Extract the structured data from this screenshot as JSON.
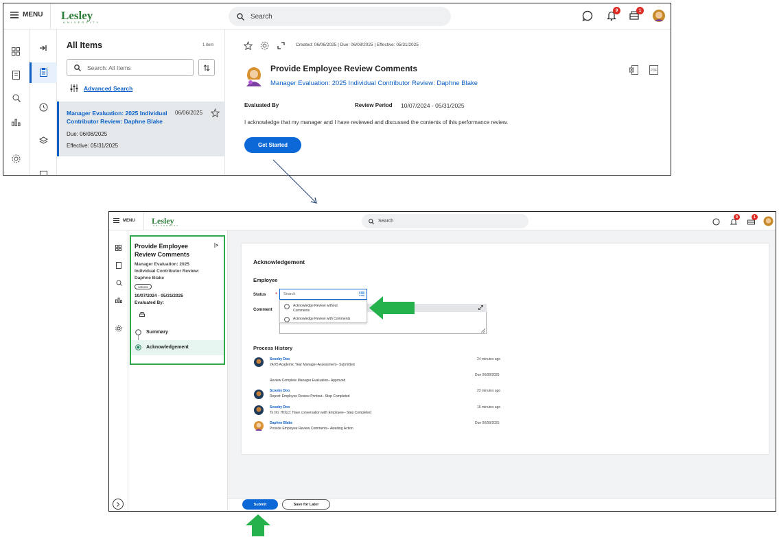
{
  "screen1": {
    "header": {
      "menu_label": "MENU",
      "logo": "Lesley",
      "logo_sub": "UNIVERSITY",
      "search_placeholder": "Search",
      "notifications_count": "9",
      "inbox_count": "1"
    },
    "list": {
      "title": "All Items",
      "count": "1 item",
      "search_placeholder": "Search: All Items",
      "advanced_search": "Advanced Search",
      "card": {
        "title": "Manager Evaluation: 2025 Individual Contributor Review: Daphne Blake",
        "date": "06/06/2025",
        "due": "Due: 06/08/2025",
        "effective": "Effective: 05/31/2025"
      }
    },
    "detail": {
      "meta": "Created: 06/06/2025 | Due: 06/08/2025 | Effective: 05/31/2025",
      "title": "Provide Employee Review Comments",
      "subtitle": "Manager Evaluation: 2025 Individual Contributor Review: Daphne Blake",
      "evaluated_by_label": "Evaluated By",
      "review_period_label": "Review Period",
      "review_period_value": "10/07/2024 - 05/31/2025",
      "acknowledgement": "I acknowledge that my manager and I have reviewed and discussed the contents of this performance review.",
      "get_started": "Get Started"
    }
  },
  "screen2": {
    "header": {
      "menu_label": "MENU",
      "logo": "Lesley",
      "logo_sub": "UNIVERSITY",
      "search_placeholder": "Search",
      "notifications_count": "9",
      "inbox_count": "1"
    },
    "side": {
      "title": "Provide Employee Review Comments",
      "subtitle": "Manager Evaluation: 2025 Individual Contributor Review: Daphne Blake",
      "actions": "Actions",
      "dates": "10/07/2024 - 05/31/2025",
      "evaluated_by": "Evaluated By:",
      "step_summary": "Summary",
      "step_ack": "Acknowledgement"
    },
    "form": {
      "heading": "Acknowledgement",
      "section": "Employee",
      "status_label": "Status",
      "status_placeholder": "Search",
      "options": [
        "Acknowledge Review without Comments",
        "Acknowledge Review with Comments"
      ],
      "comment_label": "Comment"
    },
    "history": {
      "heading": "Process History",
      "entries": [
        {
          "name": "Scooby Doo",
          "desc": "24/25 Academic Year Manager-Assessment– Submitted",
          "time": "24 minutes ago"
        },
        {
          "name": "",
          "desc": "Review Complete Manager Evaluation– Approved",
          "time": "Due 06/08/2025"
        },
        {
          "name": "Scooby Doo",
          "desc": "Report: Employee Review Printout– Step Completed",
          "time": "23 minutes ago"
        },
        {
          "name": "Scooby Doo",
          "desc": "To Do: HOLD: Have conversation with Employee– Step Completed",
          "time": "16 minutes ago"
        },
        {
          "name": "Daphne Blake",
          "desc": "Provide Employee Review Comments– Awaiting Action",
          "time": "Due 06/08/2025"
        }
      ]
    },
    "footer": {
      "submit": "Submit",
      "save_for_later": "Save for Later"
    }
  },
  "colors": {
    "accent": "#0b68d6",
    "highlight_green": "#2ea84a",
    "badge_red": "#de2c26",
    "logo_green": "#2e7d3b"
  }
}
